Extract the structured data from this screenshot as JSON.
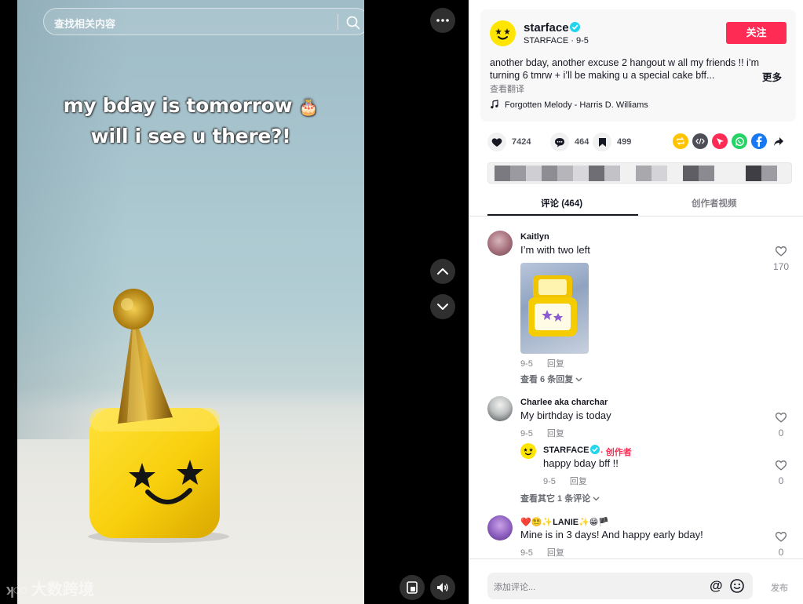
{
  "video": {
    "search_placeholder": "查找相关内容",
    "overlay_line1": "my bday is tomorrow",
    "overlay_emoji": "🎂",
    "overlay_line2": "will i see u there?!",
    "watermark": "大数跨境"
  },
  "post": {
    "author_name": "starface",
    "author_handle_date": "STARFACE · 9-5",
    "follow_label": "关注",
    "description": "another bday, another excuse 2 hangout w all my friends !! i’m turning 6 tmrw + i’ll be making u a special cake bff...",
    "more_label": "更多",
    "translate_label": "查看翻译",
    "music": "Forgotten Melody - Harris D. Williams",
    "likes": "7424",
    "comments": "464",
    "saves": "499"
  },
  "tabs": {
    "comments": "评论 (464)",
    "creator_videos": "创作者视频"
  },
  "comments": [
    {
      "name": "Kaitlyn",
      "text": "I’m with two left",
      "date": "9-5",
      "reply_label": "回复",
      "likes": "170",
      "view_replies": "查看 6 条回复"
    },
    {
      "name": "Charlee aka charchar",
      "text": "My birthday is today",
      "date": "9-5",
      "reply_label": "回复",
      "likes": "0",
      "reply": {
        "name": "STARFACE",
        "creator_tag": "· 创作者",
        "text": "happy bday bff !!",
        "date": "9-5",
        "reply_label": "回复",
        "likes": "0"
      },
      "view_replies": "查看其它 1 条评论"
    },
    {
      "name": "❤️😵‍💫✨LANIE✨😁🏴",
      "text": "Mine is in 3 days! And happy early bday!",
      "date": "9-5",
      "reply_label": "回复",
      "likes": "0"
    }
  ],
  "composer": {
    "placeholder": "添加评论...",
    "at_symbol": "@",
    "post_label": "发布"
  },
  "colors": {
    "accent": "#fe2c55",
    "verified": "#20d5ec",
    "text": "#161823"
  }
}
